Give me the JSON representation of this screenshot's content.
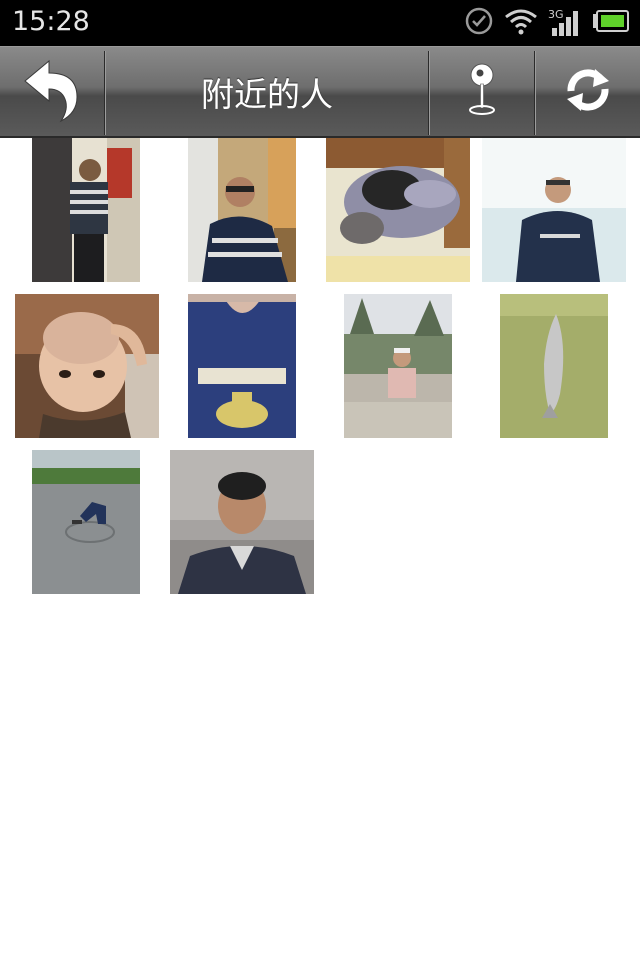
{
  "status_bar": {
    "time": "15:28",
    "network_label": "3G",
    "icons": [
      "sync-check-icon",
      "wifi-icon",
      "signal-icon",
      "battery-icon"
    ]
  },
  "title_bar": {
    "title": "附近的人",
    "back_icon": "back-arrow-icon",
    "location_icon": "location-pin-icon",
    "refresh_icon": "refresh-icon"
  },
  "people": [
    {
      "photo": "man-striped-shirt-indoors"
    },
    {
      "photo": "man-glasses-at-desk"
    },
    {
      "photo": "cat-lying-on-table"
    },
    {
      "photo": "man-glasses-white-background"
    },
    {
      "photo": "child-shaved-head"
    },
    {
      "photo": "blue-tshirt-closeup"
    },
    {
      "photo": "girl-cap-outdoors"
    },
    {
      "photo": "fish-on-green"
    },
    {
      "photo": "person-bending-on-road"
    },
    {
      "photo": "man-portrait-outdoors"
    }
  ],
  "colors": {
    "status_bar_bg": "#000000",
    "title_bar": "#6e6e6e",
    "page_bg": "#ffffff",
    "battery_fill": "#5fd12a"
  }
}
